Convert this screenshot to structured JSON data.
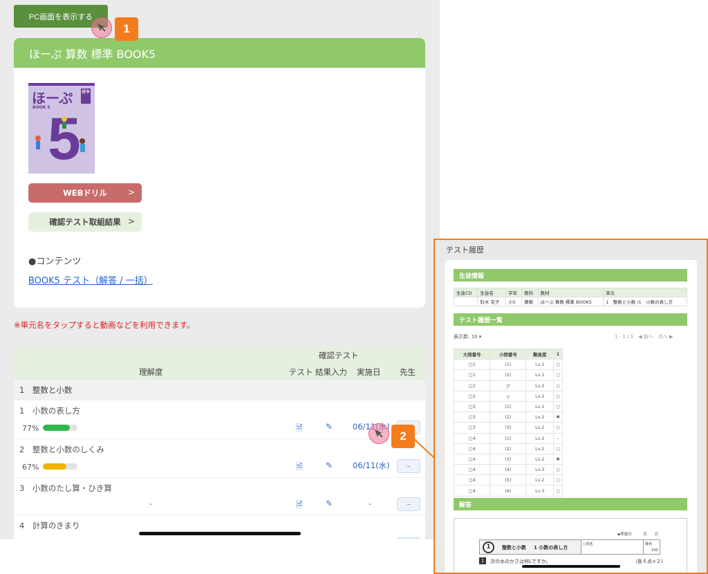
{
  "top": {
    "pc_button": "PC画面を表示する",
    "step1": "1",
    "step2": "2"
  },
  "book": {
    "title": "ほーぷ 算数 標準 BOOK5",
    "cover_title": "ほーぷ",
    "cover_sub": "BOOK 5",
    "cover_tag": "標準",
    "cover_number": "5",
    "web_drill": "WEBドリル",
    "confirm_results": "確認テスト取組結果",
    "chevron": ">",
    "contents_label": "●コンテンツ",
    "contents_link": "BOOK5 テスト（解答 / 一括）"
  },
  "note": "※単元名をタップすると動画などを利用できます。",
  "progress": {
    "header": {
      "group": "確認テスト",
      "understanding": "理解度",
      "test": "テスト",
      "result_input": "結果入力",
      "date": "実施日",
      "teacher": "先生"
    },
    "section": "1　整数と小数",
    "units": [
      {
        "name": "1　小数の表し方",
        "pct_label": "77%",
        "pct": 77,
        "color": "#2db84d",
        "date": "06/11(水)",
        "teacher": "–"
      },
      {
        "name": "2　整数と小数のしくみ",
        "pct_label": "67%",
        "pct": 67,
        "color": "#f0b400",
        "date": "06/11(水)",
        "teacher": "–"
      },
      {
        "name": "3　小数のたし算・ひき算",
        "pct_label": "-",
        "pct": 0,
        "color": "#cccccc",
        "date": "-",
        "teacher": "–"
      },
      {
        "name": "4　計算のきまり",
        "pct_label": "",
        "pct": 0,
        "color": "#cccccc",
        "date": "",
        "teacher": "–"
      }
    ]
  },
  "history": {
    "title": "テスト履歴",
    "student_info": "生徒情報",
    "info_headers": [
      "生徒CD",
      "生徒名",
      "学年",
      "教科",
      "教材",
      "単元"
    ],
    "info_row": [
      "",
      "鈴木 花子",
      "小5",
      "算数",
      "ほーぷ 算数 標準 BOOK5",
      "1　整数と小数 /1　小数の表し方"
    ],
    "list_title": "テスト履歴一覧",
    "display_count": "表示数: 10",
    "pagination": "1 - 1 / 1　◀ 前へ　次へ ▶",
    "table_headers": [
      "大問番号",
      "小問番号",
      "難易度",
      "1"
    ],
    "rows": [
      [
        "□1",
        "(1)",
        "Lv.1",
        "○"
      ],
      [
        "□1",
        "(2)",
        "Lv.1",
        "○"
      ],
      [
        "□2",
        "ア",
        "Lv.2",
        "○"
      ],
      [
        "□2",
        "イ",
        "Lv.2",
        "○"
      ],
      [
        "□3",
        "(1)",
        "Lv.1",
        "○"
      ],
      [
        "□3",
        "(2)",
        "Lv.2",
        "✖"
      ],
      [
        "□3",
        "(3)",
        "Lv.2",
        "○"
      ],
      [
        "□4",
        "(1)",
        "Lv.2",
        "-"
      ],
      [
        "□4",
        "(2)",
        "Lv.2",
        "○"
      ],
      [
        "□4",
        "(3)",
        "Lv.2",
        "✖"
      ],
      [
        "□4",
        "(4)",
        "Lv.3",
        "○"
      ],
      [
        "□4",
        "(5)",
        "Lv.2",
        "○"
      ],
      [
        "□4",
        "(6)",
        "Lv.3",
        "○"
      ]
    ],
    "answer_title": "解答",
    "sheet": {
      "date_label": "◆実施日　　　月　　日",
      "unit_num": "1",
      "unit_name": "整数と小数",
      "sub_unit": "1 小数の表し方",
      "name_label": "○氏名",
      "score_label": "得点",
      "score_max": "100",
      "q_num": "1",
      "q_text": "次の水のかさは何Lですか。",
      "q_points": "（各６点×２）"
    }
  }
}
